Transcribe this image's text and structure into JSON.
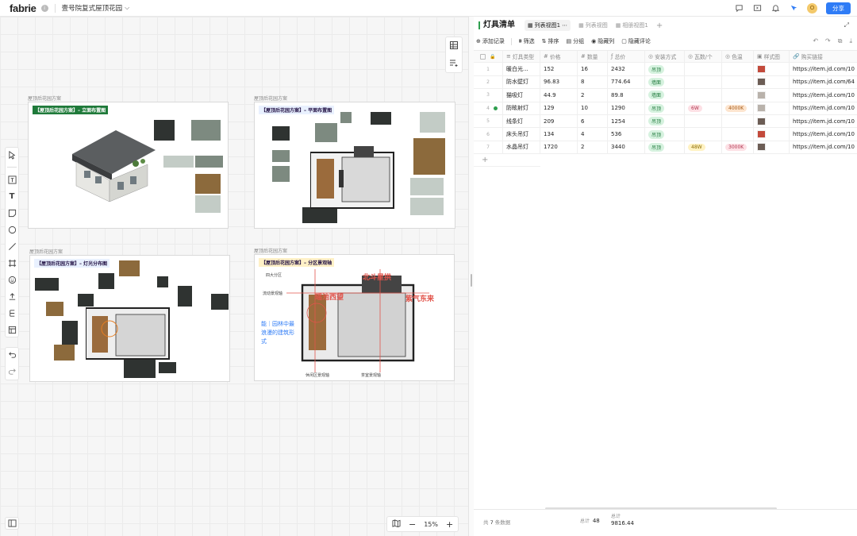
{
  "app": {
    "logo": "fabrie",
    "doc_title": "壹号院复式屋顶花园",
    "share_label": "分享",
    "avatar_letter": "O"
  },
  "canvas": {
    "zoom": "15%",
    "boards": [
      {
        "label": "屋顶后花园方案",
        "heading": "【屋顶后花园方案】– 立面布置图"
      },
      {
        "label": "屋顶后花园方案",
        "heading": "【屋顶后花园方案】– 平面布置图"
      },
      {
        "label": "屋顶后花园方案",
        "heading": "【屋顶后花园方案】– 灯光分布图"
      },
      {
        "label": "屋顶后花园方案",
        "heading": "【屋顶后花园方案】– 分区景观轴"
      }
    ],
    "zone_labels": {
      "left_top": "四大分区",
      "flow": "流动景观轴",
      "north": "北斗星拱",
      "west": "瑶池西望",
      "east": "紫气东来",
      "poem": "能｜园林中最浪漫的建筑形式",
      "bottom_left": "休闲区景观轴",
      "bottom_right": "茶室景观轴"
    }
  },
  "table": {
    "title": "灯具清单",
    "views": [
      "列表视图1",
      "列表视图",
      "相册视图1"
    ],
    "actions": [
      "添加记录",
      "筛选",
      "排序",
      "分组",
      "隐藏列",
      "隐藏评论"
    ],
    "columns": [
      "灯具类型",
      "价格",
      "数量",
      "总价",
      "安装方式",
      "瓦数/个",
      "色温",
      "样式图",
      "购买链接"
    ],
    "rows": [
      {
        "idx": "1",
        "name": "暖白光...",
        "price": "152",
        "qty": "16",
        "total": "2432",
        "install": "吊顶",
        "watt": "",
        "temp": "",
        "link": "https://item.jd.com/10"
      },
      {
        "idx": "2",
        "name": "防水壁灯",
        "price": "96.83",
        "qty": "8",
        "total": "774.64",
        "install": "墙面",
        "watt": "",
        "temp": "",
        "link": "https://item.jd.com/64"
      },
      {
        "idx": "3",
        "name": "猫吸灯",
        "price": "44.9",
        "qty": "2",
        "total": "89.8",
        "install": "墙面",
        "watt": "",
        "temp": "",
        "link": "https://item.jd.com/10"
      },
      {
        "idx": "4",
        "name": "防眩射灯",
        "price": "129",
        "qty": "10",
        "total": "1290",
        "install": "吊顶",
        "watt": "6W",
        "temp": "4000K",
        "link": "https://item.jd.com/10"
      },
      {
        "idx": "5",
        "name": "线条灯",
        "price": "209",
        "qty": "6",
        "total": "1254",
        "install": "吊顶",
        "watt": "",
        "temp": "",
        "link": "https://item.jd.com/10"
      },
      {
        "idx": "6",
        "name": "床头吊灯",
        "price": "134",
        "qty": "4",
        "total": "536",
        "install": "吊顶",
        "watt": "",
        "temp": "",
        "link": "https://item.jd.com/10"
      },
      {
        "idx": "7",
        "name": "水晶吊灯",
        "price": "1720",
        "qty": "2",
        "total": "3440",
        "install": "吊顶",
        "watt": "48W",
        "temp": "3000K",
        "link": "https://item.jd.com/10"
      }
    ],
    "footer": {
      "count_prefix": "共",
      "count": "7",
      "count_suffix": "条数据",
      "sum_label": "总计",
      "qty_sum": "48",
      "total_sum": "9816.44"
    }
  }
}
